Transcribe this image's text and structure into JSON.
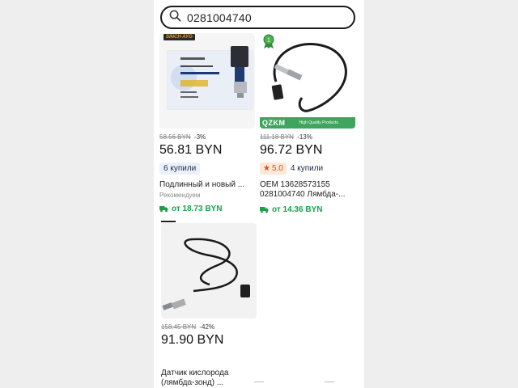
{
  "search": {
    "query": "0281004740"
  },
  "products": [
    {
      "old_price": "58.56 BYN",
      "discount": "-3%",
      "price": "56.81 BYN",
      "bought_badge": "6 купили",
      "title": "Подлинный и новый ...",
      "subtitle": "Рекомендуем",
      "shipping": "от 18.73 BYN",
      "store_tag": "SINCH AYO"
    },
    {
      "old_price": "111.18 BYN",
      "discount": "-13%",
      "price": "96.72 BYN",
      "rating": "5.0",
      "bought": "4 купили",
      "title_line1": "OEM 13628573155",
      "title_line2": "0281004740   Лямбда-...",
      "shipping": "от 14.36 BYN",
      "brand": "QZKM",
      "brand_tagline": "High Quality Products",
      "medal_number": "1"
    },
    {
      "old_price": "158.45 BYN",
      "discount": "-42%",
      "price": "91.90 BYN",
      "title_line1": "Датчик кислорода",
      "title_line2": "(лямбда-зонд) ..."
    }
  ],
  "colors": {
    "accent_green": "#1aa14a",
    "rating_orange": "#d4551a",
    "badge_bg": "#eaf1fb"
  }
}
